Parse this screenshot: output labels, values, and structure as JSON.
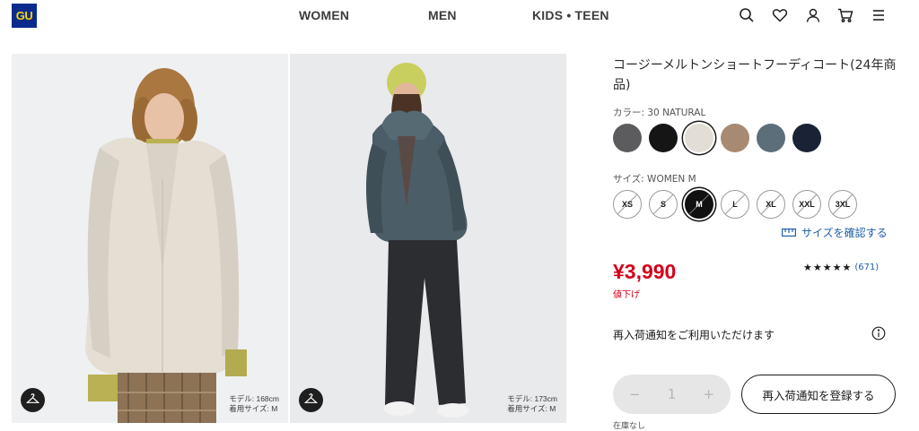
{
  "header": {
    "logo": "GU",
    "nav": [
      "WOMEN",
      "MEN",
      "KIDS • TEEN"
    ],
    "icons": [
      "search-icon",
      "heart-icon",
      "user-icon",
      "cart-icon",
      "menu-icon"
    ]
  },
  "images": [
    {
      "model_height": "モデル: 168cm",
      "model_size": "着用サイズ: M",
      "icon": "hanger-icon"
    },
    {
      "model_height": "モデル: 173cm",
      "model_size": "着用サイズ: M",
      "icon": "hanger-icon"
    }
  ],
  "product": {
    "title": "コージーメルトンショートフーディコート(24年商品)",
    "color_label": "カラー: 30 NATURAL",
    "colors": [
      "#5c5c5e",
      "#151515",
      "#e2ded5",
      "#a88a72",
      "#5c6e7a",
      "#1a2236"
    ],
    "selected_color_index": 2,
    "size_label": "サイズ: WOMEN M",
    "sizes": [
      "XS",
      "S",
      "M",
      "L",
      "XL",
      "XXL",
      "3XL"
    ],
    "selected_size_index": 2,
    "size_check_label": "サイズを確認する",
    "price": "¥3,990",
    "price_note": "値下げ",
    "rating_stars": "★★★★★",
    "review_count": "(671)",
    "restock_message": "再入荷通知をご利用いただけます",
    "quantity": "1",
    "qty_minus": "−",
    "qty_plus": "+",
    "restock_button": "再入荷通知を登録する",
    "stock_note": "在庫なし"
  }
}
